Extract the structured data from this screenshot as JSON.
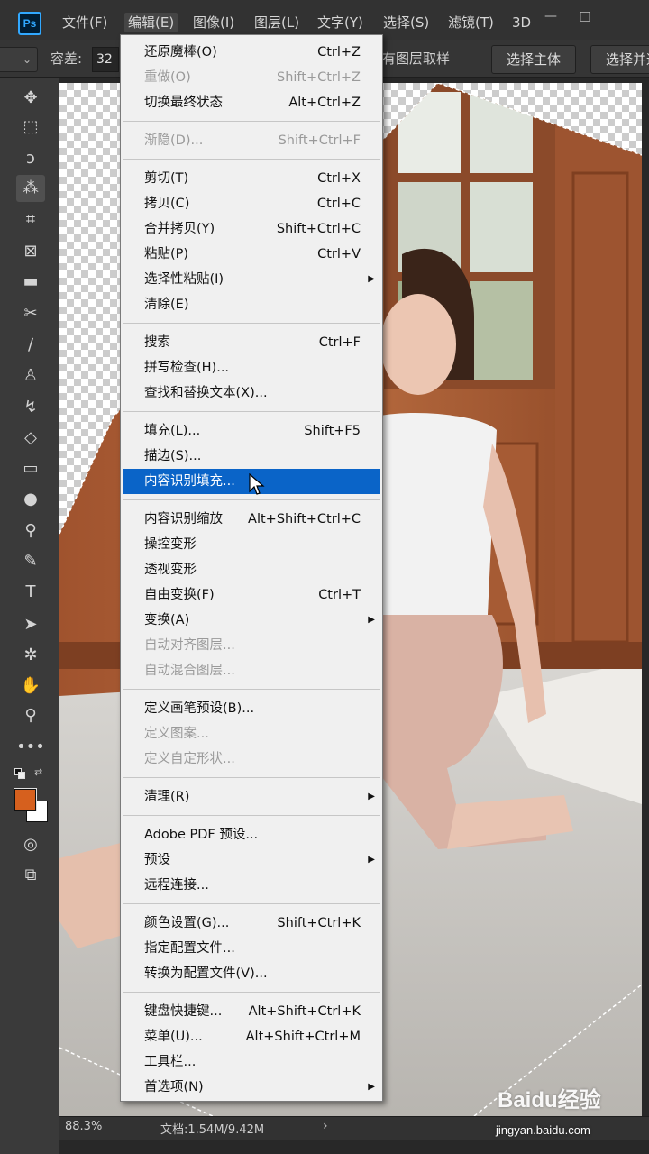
{
  "app": {
    "logo": "Ps"
  },
  "menubar": {
    "items": [
      {
        "label": "文件(F)"
      },
      {
        "label": "编辑(E)"
      },
      {
        "label": "图像(I)"
      },
      {
        "label": "图层(L)"
      },
      {
        "label": "文字(Y)"
      },
      {
        "label": "选择(S)"
      },
      {
        "label": "滤镜(T)"
      },
      {
        "label": "3D"
      }
    ],
    "window_controls": {
      "minimize": "—",
      "maximize": "□"
    }
  },
  "options": {
    "tolerance_label": "容差:",
    "tolerance_value": "32",
    "sample_all_layers": "有图层取样",
    "select_subject": "选择主体",
    "select_and_mask": "选择并遮"
  },
  "edit_menu": {
    "groups": [
      [
        {
          "label": "还原魔棒(O)",
          "shortcut": "Ctrl+Z",
          "enabled": true
        },
        {
          "label": "重做(O)",
          "shortcut": "Shift+Ctrl+Z",
          "enabled": false
        },
        {
          "label": "切换最终状态",
          "shortcut": "Alt+Ctrl+Z",
          "enabled": true
        }
      ],
      [
        {
          "label": "渐隐(D)...",
          "shortcut": "Shift+Ctrl+F",
          "enabled": false
        }
      ],
      [
        {
          "label": "剪切(T)",
          "shortcut": "Ctrl+X",
          "enabled": true
        },
        {
          "label": "拷贝(C)",
          "shortcut": "Ctrl+C",
          "enabled": true
        },
        {
          "label": "合并拷贝(Y)",
          "shortcut": "Shift+Ctrl+C",
          "enabled": true
        },
        {
          "label": "粘贴(P)",
          "shortcut": "Ctrl+V",
          "enabled": true
        },
        {
          "label": "选择性粘贴(I)",
          "shortcut": "",
          "enabled": true,
          "submenu": true
        },
        {
          "label": "清除(E)",
          "shortcut": "",
          "enabled": true
        }
      ],
      [
        {
          "label": "搜索",
          "shortcut": "Ctrl+F",
          "enabled": true
        },
        {
          "label": "拼写检查(H)...",
          "shortcut": "",
          "enabled": true
        },
        {
          "label": "查找和替换文本(X)...",
          "shortcut": "",
          "enabled": true
        }
      ],
      [
        {
          "label": "填充(L)...",
          "shortcut": "Shift+F5",
          "enabled": true
        },
        {
          "label": "描边(S)...",
          "shortcut": "",
          "enabled": true
        },
        {
          "label": "内容识别填充...",
          "shortcut": "",
          "enabled": true,
          "highlighted": true
        }
      ],
      [
        {
          "label": "内容识别缩放",
          "shortcut": "Alt+Shift+Ctrl+C",
          "enabled": true
        },
        {
          "label": "操控变形",
          "shortcut": "",
          "enabled": true
        },
        {
          "label": "透视变形",
          "shortcut": "",
          "enabled": true
        },
        {
          "label": "自由变换(F)",
          "shortcut": "Ctrl+T",
          "enabled": true
        },
        {
          "label": "变换(A)",
          "shortcut": "",
          "enabled": true,
          "submenu": true
        },
        {
          "label": "自动对齐图层...",
          "shortcut": "",
          "enabled": false
        },
        {
          "label": "自动混合图层...",
          "shortcut": "",
          "enabled": false
        }
      ],
      [
        {
          "label": "定义画笔预设(B)...",
          "shortcut": "",
          "enabled": true
        },
        {
          "label": "定义图案...",
          "shortcut": "",
          "enabled": false
        },
        {
          "label": "定义自定形状...",
          "shortcut": "",
          "enabled": false
        }
      ],
      [
        {
          "label": "清理(R)",
          "shortcut": "",
          "enabled": true,
          "submenu": true
        }
      ],
      [
        {
          "label": "Adobe PDF 预设...",
          "shortcut": "",
          "enabled": true
        },
        {
          "label": "预设",
          "shortcut": "",
          "enabled": true,
          "submenu": true
        },
        {
          "label": "远程连接...",
          "shortcut": "",
          "enabled": true
        }
      ],
      [
        {
          "label": "颜色设置(G)...",
          "shortcut": "Shift+Ctrl+K",
          "enabled": true
        },
        {
          "label": "指定配置文件...",
          "shortcut": "",
          "enabled": true
        },
        {
          "label": "转换为配置文件(V)...",
          "shortcut": "",
          "enabled": true
        }
      ],
      [
        {
          "label": "键盘快捷键...",
          "shortcut": "Alt+Shift+Ctrl+K",
          "enabled": true
        },
        {
          "label": "菜单(U)...",
          "shortcut": "Alt+Shift+Ctrl+M",
          "enabled": true
        },
        {
          "label": "工具栏...",
          "shortcut": "",
          "enabled": true
        },
        {
          "label": "首选项(N)",
          "shortcut": "",
          "enabled": true,
          "submenu": true
        }
      ]
    ]
  },
  "toolbar": {
    "tools": [
      {
        "name": "move-tool-icon",
        "glyph": "✥"
      },
      {
        "name": "marquee-tool-icon",
        "glyph": "⬚"
      },
      {
        "name": "lasso-tool-icon",
        "glyph": "ↄ"
      },
      {
        "name": "magic-wand-tool-icon",
        "glyph": "⁂",
        "active": true
      },
      {
        "name": "crop-tool-icon",
        "glyph": "⌗"
      },
      {
        "name": "frame-tool-icon",
        "glyph": "⊠"
      },
      {
        "name": "ruler-tool-icon",
        "glyph": "▬"
      },
      {
        "name": "healing-brush-tool-icon",
        "glyph": "✂"
      },
      {
        "name": "brush-tool-icon",
        "glyph": "∕"
      },
      {
        "name": "clone-stamp-tool-icon",
        "glyph": "♙"
      },
      {
        "name": "history-brush-tool-icon",
        "glyph": "↯"
      },
      {
        "name": "eraser-tool-icon",
        "glyph": "◇"
      },
      {
        "name": "gradient-tool-icon",
        "glyph": "▭"
      },
      {
        "name": "blur-tool-icon",
        "glyph": "●"
      },
      {
        "name": "dodge-tool-icon",
        "glyph": "⚲"
      },
      {
        "name": "pen-tool-icon",
        "glyph": "✎"
      },
      {
        "name": "type-tool-icon",
        "glyph": "T"
      },
      {
        "name": "path-selection-tool-icon",
        "glyph": "➤"
      },
      {
        "name": "custom-shape-tool-icon",
        "glyph": "✲"
      },
      {
        "name": "hand-tool-icon",
        "glyph": "✋"
      },
      {
        "name": "zoom-tool-icon",
        "glyph": "⚲"
      },
      {
        "name": "more-tools-icon",
        "glyph": "•••"
      }
    ],
    "foreground_color": "#d6601e",
    "background_color": "#ffffff",
    "bottom_tools": [
      {
        "name": "quick-mask-icon",
        "glyph": "◎"
      },
      {
        "name": "screen-mode-icon",
        "glyph": "⧉"
      }
    ]
  },
  "status": {
    "zoom": "88.3%",
    "doc_size": "文档:1.54M/9.42M",
    "arrow": "›"
  },
  "watermark": {
    "brand": "Baidu经验",
    "url": "jingyan.baidu.com"
  }
}
